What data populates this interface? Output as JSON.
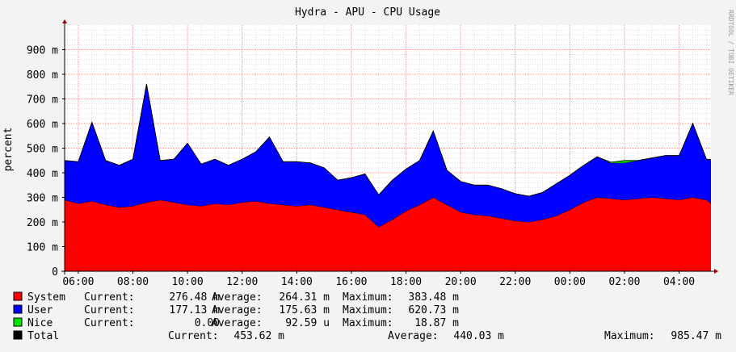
{
  "chart_data": {
    "type": "area",
    "title": "Hydra - APU - CPU Usage",
    "ylabel": "percent",
    "watermark": "RRDTOOL / TOBI OETIKER",
    "ylim": [
      0,
      1000
    ],
    "stacked": true,
    "grid": true,
    "y_ticks": [
      {
        "value": 0,
        "label": "0"
      },
      {
        "value": 100,
        "label": "100 m"
      },
      {
        "value": 200,
        "label": "200 m"
      },
      {
        "value": 300,
        "label": "300 m"
      },
      {
        "value": 400,
        "label": "400 m"
      },
      {
        "value": 500,
        "label": "500 m"
      },
      {
        "value": 600,
        "label": "600 m"
      },
      {
        "value": 700,
        "label": "700 m"
      },
      {
        "value": 800,
        "label": "800 m"
      },
      {
        "value": 900,
        "label": "900 m"
      }
    ],
    "x_range": [
      "05:30",
      "05:10"
    ],
    "x_ticks": [
      "06:00",
      "08:00",
      "10:00",
      "12:00",
      "14:00",
      "16:00",
      "18:00",
      "20:00",
      "22:00",
      "00:00",
      "02:00",
      "04:00"
    ],
    "x": [
      "05:30",
      "06:00",
      "06:30",
      "07:00",
      "07:30",
      "08:00",
      "08:30",
      "09:00",
      "09:30",
      "10:00",
      "10:30",
      "11:00",
      "11:30",
      "12:00",
      "12:30",
      "13:00",
      "13:30",
      "14:00",
      "14:30",
      "15:00",
      "15:30",
      "16:00",
      "16:30",
      "17:00",
      "17:30",
      "18:00",
      "18:30",
      "19:00",
      "19:30",
      "20:00",
      "20:30",
      "21:00",
      "21:30",
      "22:00",
      "22:30",
      "23:00",
      "23:30",
      "00:00",
      "00:30",
      "01:00",
      "01:30",
      "02:00",
      "02:30",
      "03:00",
      "03:30",
      "04:00",
      "04:30",
      "05:00",
      "05:10"
    ],
    "series": [
      {
        "name": "System",
        "color": "#ff0000",
        "values": [
          290,
          275,
          285,
          270,
          260,
          265,
          280,
          290,
          280,
          270,
          265,
          275,
          270,
          280,
          285,
          275,
          270,
          265,
          270,
          260,
          250,
          240,
          230,
          180,
          210,
          245,
          270,
          300,
          270,
          240,
          230,
          225,
          215,
          205,
          200,
          210,
          225,
          250,
          280,
          300,
          295,
          290,
          295,
          300,
          295,
          290,
          300,
          290,
          276
        ]
      },
      {
        "name": "User",
        "color": "#0000ff",
        "values": [
          160,
          170,
          320,
          180,
          170,
          190,
          480,
          160,
          175,
          250,
          170,
          180,
          160,
          175,
          200,
          270,
          175,
          180,
          170,
          160,
          120,
          140,
          165,
          130,
          160,
          170,
          180,
          270,
          140,
          125,
          120,
          125,
          120,
          110,
          105,
          110,
          130,
          140,
          150,
          165,
          145,
          150,
          155,
          160,
          175,
          180,
          300,
          165,
          177
        ]
      },
      {
        "name": "Nice",
        "color": "#00e600",
        "values": [
          0,
          0,
          0,
          0,
          0,
          0,
          0,
          0,
          0,
          0,
          0,
          0,
          0,
          0,
          0,
          0,
          0,
          0,
          0,
          0,
          0,
          0,
          0,
          0,
          0,
          0,
          0,
          0,
          0,
          0,
          0,
          0,
          0,
          0,
          0,
          0,
          0,
          0,
          0,
          0,
          3,
          10,
          0,
          0,
          0,
          0,
          0,
          0,
          0
        ]
      }
    ]
  },
  "legend": {
    "rows": [
      {
        "name": "System",
        "color": "#ff0000",
        "current_label": "Current:",
        "current": "276.48 m",
        "average_label": "Average:",
        "average": "264.31 m",
        "maximum_label": "Maximum:",
        "maximum": "383.48 m"
      },
      {
        "name": "User",
        "color": "#0000ff",
        "current_label": "Current:",
        "current": "177.13 m",
        "average_label": "Average:",
        "average": "175.63 m",
        "maximum_label": "Maximum:",
        "maximum": "620.73 m"
      },
      {
        "name": "Nice",
        "color": "#00e600",
        "current_label": "Current:",
        "current": "0.00",
        "average_label": "Average:",
        "average": "92.59 u",
        "maximum_label": "Maximum:",
        "maximum": "18.87 m"
      }
    ],
    "total": {
      "name": "Total",
      "color": "#000000",
      "current_label": "Current:",
      "current": "453.62 m",
      "average_label": "Average:",
      "average": "440.03 m",
      "maximum_label": "Maximum:",
      "maximum": "985.47 m"
    }
  }
}
